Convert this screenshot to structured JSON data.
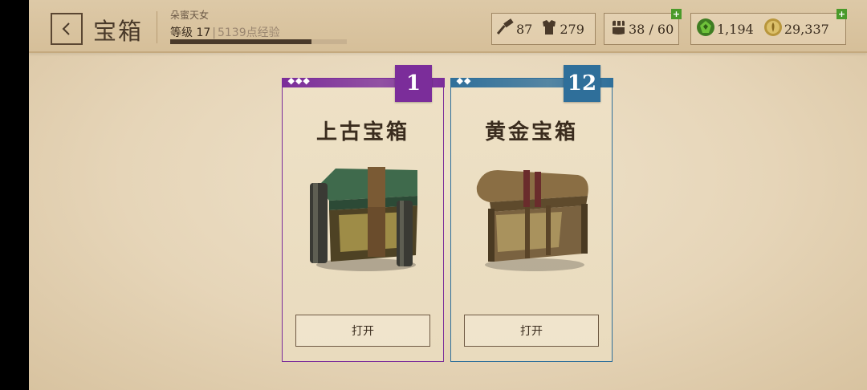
{
  "header": {
    "title": "宝箱",
    "player_name": "朵蜜天女",
    "level_label": "等级 17",
    "separator": "|",
    "xp_label": "5139点经验",
    "xp_progress": 0.8
  },
  "resources": {
    "hammer_value": "87",
    "armor_value": "279",
    "inventory_value": "38 / 60",
    "gem_value": "1,194",
    "gold_value": "29,337",
    "plus_label": "+"
  },
  "chests": [
    {
      "name": "上古宝箱",
      "count": "1",
      "rarity_marks": "◆◆◆",
      "open_label": "打开",
      "color": "#7b2d9a"
    },
    {
      "name": "黄金宝箱",
      "count": "12",
      "rarity_marks": "◆◆",
      "open_label": "打开",
      "color": "#2f6f9a"
    }
  ],
  "icons": [
    "back-chevron-icon",
    "hammer-icon",
    "armor-icon",
    "inventory-icon",
    "gem-icon",
    "gold-coin-icon"
  ]
}
